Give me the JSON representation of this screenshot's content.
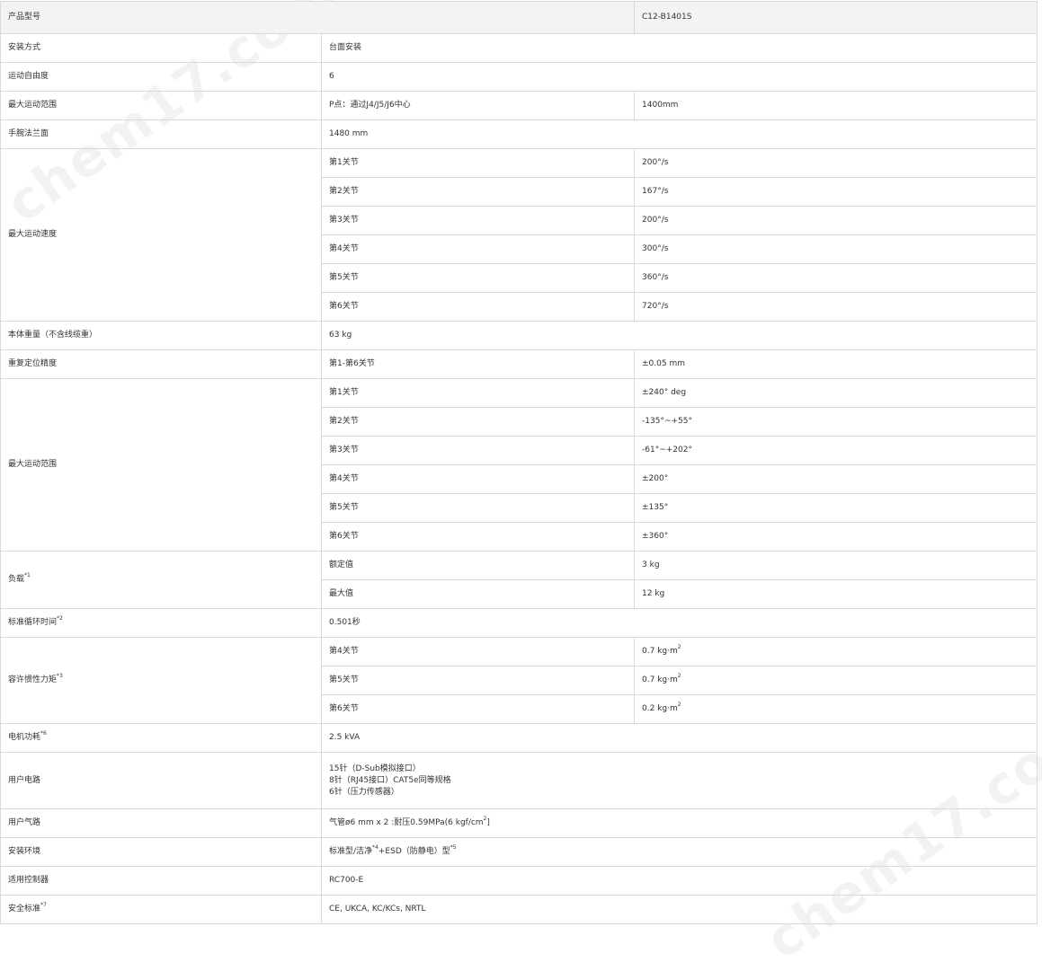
{
  "header": {
    "label": "产品型号",
    "value": "C12-B1401S"
  },
  "rows": {
    "mount": {
      "label": "安装方式",
      "value": "台面安装"
    },
    "dof": {
      "label": "运动自由度",
      "value": "6"
    },
    "reach": {
      "label": "最大运动范围",
      "sub": "P点：通过J4/J5/J6中心",
      "value": "1400mm"
    },
    "wrist_flange": {
      "label": "手腕法兰面",
      "value": "1480 mm"
    },
    "speed": {
      "label": "最大运动速度",
      "joints": [
        {
          "joint": "第1关节",
          "value": "200°/s"
        },
        {
          "joint": "第2关节",
          "value": "167°/s"
        },
        {
          "joint": "第3关节",
          "value": "200°/s"
        },
        {
          "joint": "第4关节",
          "value": "300°/s"
        },
        {
          "joint": "第5关节",
          "value": "360°/s"
        },
        {
          "joint": "第6关节",
          "value": "720°/s"
        }
      ]
    },
    "weight": {
      "label": "本体重量（不含线缆重）",
      "value": "63 kg"
    },
    "repeat": {
      "label": "重复定位精度",
      "sub": "第1-第6关节",
      "value": "±0.05 mm"
    },
    "range": {
      "label": "最大运动范围",
      "joints": [
        {
          "joint": "第1关节",
          "value": "±240° deg"
        },
        {
          "joint": "第2关节",
          "value": "-135°~+55°"
        },
        {
          "joint": "第3关节",
          "value": "-61°~+202°"
        },
        {
          "joint": "第4关节",
          "value": "±200°"
        },
        {
          "joint": "第5关节",
          "value": "±135°"
        },
        {
          "joint": "第6关节",
          "value": "±360°"
        }
      ]
    },
    "payload": {
      "label": "负载",
      "note": "*1",
      "rated_label": "额定值",
      "rated_value": "3 kg",
      "max_label": "最大值",
      "max_value": "12 kg"
    },
    "cycle": {
      "label": "标准循环时间",
      "note": "*2",
      "value": "0.501秒"
    },
    "inertia": {
      "label": "容许惯性力矩",
      "note": "*3",
      "joints": [
        {
          "joint": "第4关节",
          "value": "0.7 kg·m",
          "exp": "2"
        },
        {
          "joint": "第5关节",
          "value": "0.7 kg·m",
          "exp": "2"
        },
        {
          "joint": "第6关节",
          "value": "0.2 kg·m",
          "exp": "2"
        }
      ]
    },
    "power": {
      "label": "电机功耗",
      "note": "*6",
      "value": "2.5 kVA"
    },
    "user_circuit": {
      "label": "用户电路",
      "line1": "15针（D-Sub模拟接口）",
      "line2": "8针（RJ45接口）CAT5e同等规格",
      "line3": "6针（压力传感器）"
    },
    "user_air": {
      "label": "用户气路",
      "value_pre": "气管ø6 mm x 2 :耐压0.59MPa(6 kgf/cm",
      "exp": "2",
      "value_post": "]"
    },
    "env": {
      "label": "安装环境",
      "v1": "标准型/洁净",
      "n1": "*4",
      "v2": "+ESD（防静电）型",
      "n2": "*5"
    },
    "controller": {
      "label": "适用控制器",
      "value": "RC700-E"
    },
    "safety": {
      "label": "安全标准",
      "note": "*7",
      "value": "CE, UKCA, KC/KCs, NRTL"
    }
  },
  "watermark": "chem17.com"
}
